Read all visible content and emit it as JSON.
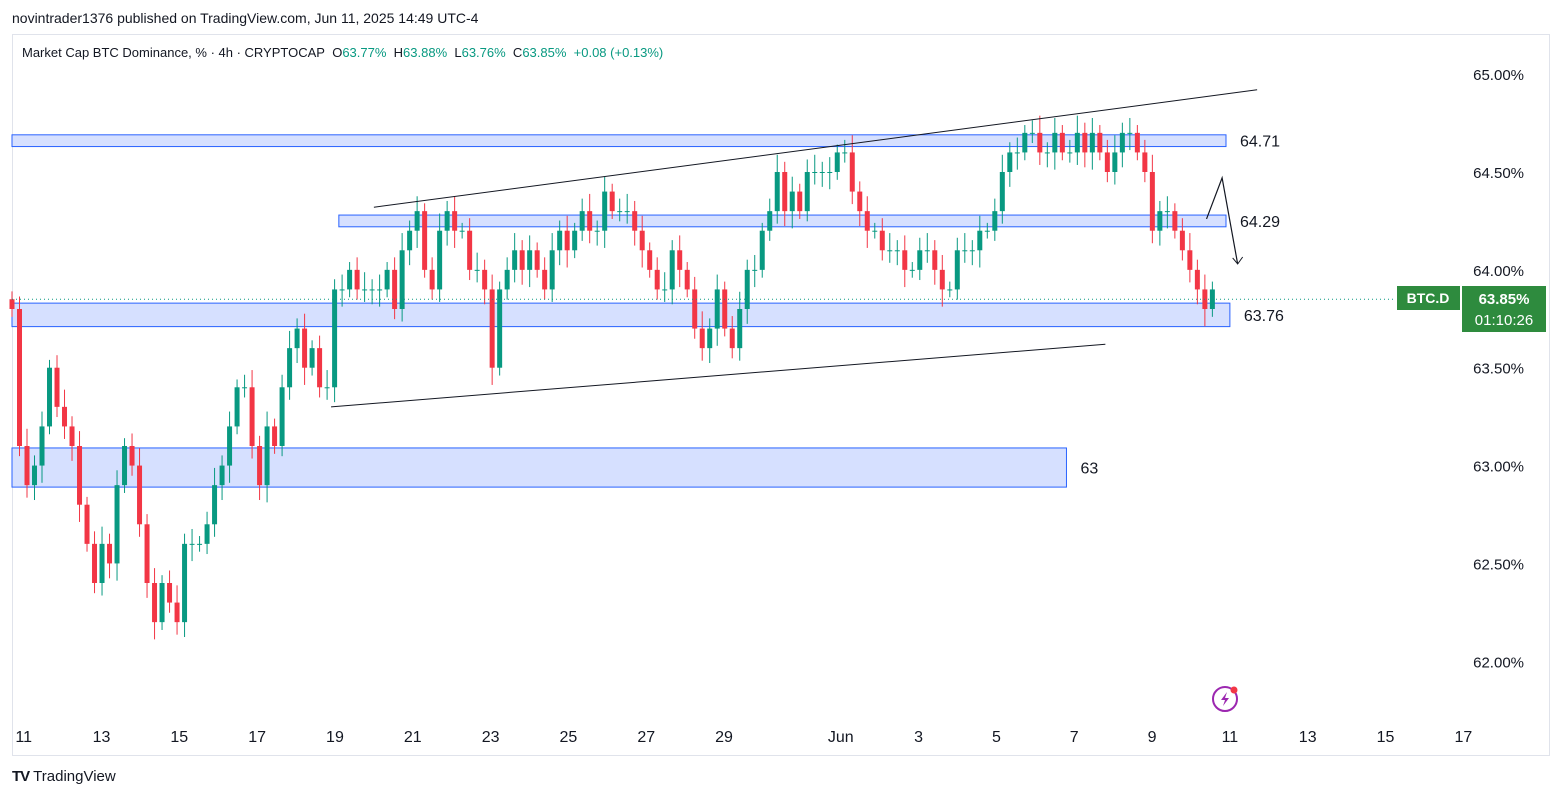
{
  "header": {
    "publisher": "novintrader1376 published on TradingView.com, Jun 11, 2025 14:49 UTC-4"
  },
  "legend": {
    "title": "Market Cap BTC Dominance, % · 4h · CRYPTOCAP",
    "open_label": "O",
    "open": "63.77%",
    "high_label": "H",
    "high": "63.88%",
    "low_label": "L",
    "low": "63.76%",
    "close_label": "C",
    "close": "63.85%",
    "change": "+0.08 (+0.13%)"
  },
  "price_badge": {
    "symbol": "BTC.D",
    "price": "63.85%",
    "countdown": "01:10:26"
  },
  "footer": {
    "logo": "TV",
    "brand": "TradingView"
  },
  "colors": {
    "up": "#089981",
    "down": "#f23645",
    "zone_fill": "#d6e0ff",
    "zone_stroke": "#2962ff",
    "badge": "#2e8b3e"
  },
  "chart_data": {
    "type": "candlestick",
    "y_axis": {
      "min": 61.7,
      "max": 65.2,
      "ticks": [
        "65.00%",
        "64.50%",
        "64.00%",
        "63.50%",
        "63.00%",
        "62.50%",
        "62.00%"
      ],
      "tick_values": [
        65.0,
        64.5,
        64.0,
        63.5,
        63.0,
        62.5,
        62.0
      ]
    },
    "x_axis": {
      "start_day": 10.7,
      "end_day": 47.4,
      "ticks": [
        {
          "label": "11",
          "day": 11
        },
        {
          "label": "13",
          "day": 13
        },
        {
          "label": "15",
          "day": 15
        },
        {
          "label": "17",
          "day": 17
        },
        {
          "label": "19",
          "day": 19
        },
        {
          "label": "21",
          "day": 21
        },
        {
          "label": "23",
          "day": 23
        },
        {
          "label": "25",
          "day": 25
        },
        {
          "label": "27",
          "day": 27
        },
        {
          "label": "29",
          "day": 29
        },
        {
          "label": "Jun",
          "day": 32
        },
        {
          "label": "3",
          "day": 34
        },
        {
          "label": "5",
          "day": 36
        },
        {
          "label": "7",
          "day": 38
        },
        {
          "label": "9",
          "day": 40
        },
        {
          "label": "11",
          "day": 42
        },
        {
          "label": "13",
          "day": 44
        },
        {
          "label": "15",
          "day": 46
        },
        {
          "label": "17",
          "day": 48
        }
      ]
    },
    "closes": [
      63.8,
      63.1,
      62.9,
      63.0,
      63.2,
      63.5,
      63.3,
      63.2,
      63.1,
      62.8,
      62.6,
      62.4,
      62.6,
      62.5,
      62.9,
      63.1,
      63.0,
      62.7,
      62.4,
      62.2,
      62.4,
      62.3,
      62.2,
      62.6,
      62.6,
      62.6,
      62.7,
      62.9,
      63.0,
      63.2,
      63.4,
      63.4,
      63.1,
      62.9,
      63.2,
      63.1,
      63.4,
      63.6,
      63.7,
      63.5,
      63.6,
      63.4,
      63.4,
      63.9,
      63.9,
      64.0,
      63.9,
      63.9,
      63.9,
      63.9,
      64.0,
      63.8,
      64.1,
      64.2,
      64.3,
      64.0,
      63.9,
      64.2,
      64.3,
      64.2,
      64.2,
      64.0,
      64.0,
      63.9,
      63.5,
      63.9,
      64.0,
      64.1,
      64.0,
      64.1,
      64.0,
      63.9,
      64.1,
      64.2,
      64.1,
      64.2,
      64.3,
      64.2,
      64.2,
      64.4,
      64.3,
      64.3,
      64.3,
      64.2,
      64.1,
      64.0,
      63.9,
      63.9,
      64.1,
      64.0,
      63.9,
      63.7,
      63.6,
      63.7,
      63.9,
      63.7,
      63.6,
      63.8,
      64.0,
      64.0,
      64.2,
      64.3,
      64.5,
      64.3,
      64.4,
      64.3,
      64.5,
      64.5,
      64.5,
      64.5,
      64.6,
      64.6,
      64.4,
      64.3,
      64.2,
      64.2,
      64.1,
      64.1,
      64.1,
      64.0,
      64.0,
      64.1,
      64.1,
      64.0,
      63.9,
      63.9,
      64.1,
      64.1,
      64.1,
      64.2,
      64.2,
      64.3,
      64.5,
      64.6,
      64.6,
      64.7,
      64.7,
      64.6,
      64.6,
      64.7,
      64.6,
      64.6,
      64.7,
      64.6,
      64.7,
      64.6,
      64.5,
      64.6,
      64.7,
      64.7,
      64.6,
      64.5,
      64.2,
      64.3,
      64.3,
      64.2,
      64.1,
      64.0,
      63.9,
      63.8,
      63.9
    ],
    "zones": [
      {
        "label": "64.71",
        "top": 64.69,
        "bottom": 64.63,
        "from_day": 10.7,
        "to_day": 41.9
      },
      {
        "label": "64.29",
        "top": 64.28,
        "bottom": 64.22,
        "from_day": 19.1,
        "to_day": 41.9
      },
      {
        "label": "63.76",
        "top": 63.83,
        "bottom": 63.71,
        "from_day": 10.7,
        "to_day": 42.0
      },
      {
        "label": "63",
        "top": 63.09,
        "bottom": 62.89,
        "from_day": 10.7,
        "to_day": 37.8
      }
    ],
    "trendlines": [
      {
        "from": {
          "day": 20.0,
          "value": 64.32
        },
        "to": {
          "day": 42.7,
          "value": 64.92
        }
      },
      {
        "from": {
          "day": 18.9,
          "value": 63.3
        },
        "to": {
          "day": 38.8,
          "value": 63.62
        }
      }
    ],
    "projection": [
      {
        "day": 41.4,
        "value": 64.26
      },
      {
        "day": 41.8,
        "value": 64.47
      },
      {
        "day": 42.2,
        "value": 64.03
      }
    ],
    "last_price": 63.85
  }
}
